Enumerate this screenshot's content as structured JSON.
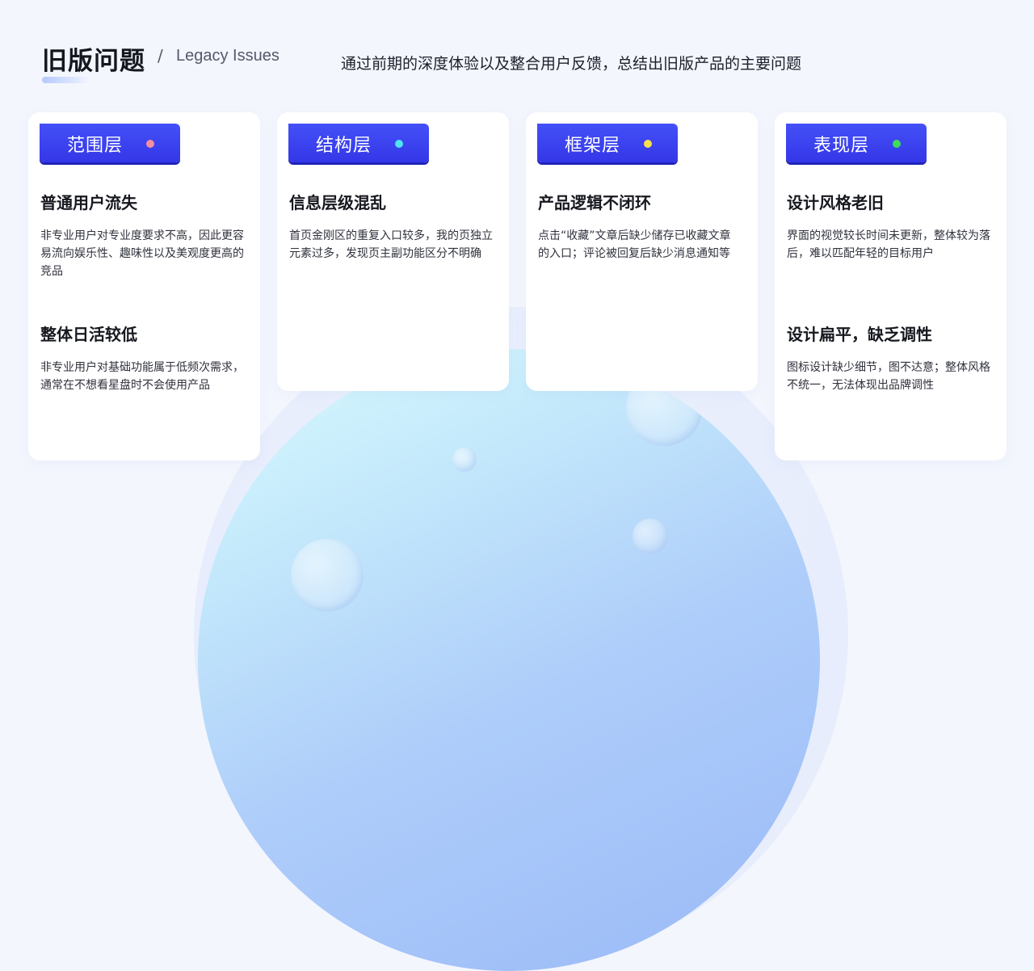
{
  "header": {
    "title": "旧版问题",
    "slash": "/",
    "title_en": "Legacy Issues",
    "subtitle": "通过前期的深度体验以及整合用户反馈，总结出旧版产品的主要问题"
  },
  "colors": {
    "tag_blue": "#3a3ff0",
    "background": "#f3f6fd",
    "card": "#ffffff"
  },
  "cards": [
    {
      "tag": "范围层",
      "dot_color": "#f58fa0",
      "issues": [
        {
          "title": "普通用户流失",
          "text": "非专业用户对专业度要求不高，因此更容易流向娱乐性、趣味性以及美观度更高的竞品"
        },
        {
          "title": "整体日活较低",
          "text": "非专业用户对基础功能属于低频次需求，通常在不想看星盘时不会使用产品"
        }
      ]
    },
    {
      "tag": "结构层",
      "dot_color": "#4ee4f0",
      "issues": [
        {
          "title": "信息层级混乱",
          "text": "首页金刚区的重复入口较多，我的页独立元素过多，发现页主副功能区分不明确"
        }
      ]
    },
    {
      "tag": "框架层",
      "dot_color": "#f7e04a",
      "issues": [
        {
          "title": "产品逻辑不闭环",
          "text": "点击“收藏”文章后缺少储存已收藏文章的入口；评论被回复后缺少消息通知等"
        }
      ]
    },
    {
      "tag": "表现层",
      "dot_color": "#3ddc5a",
      "issues": [
        {
          "title": "设计风格老旧",
          "text": "界面的视觉较长时间未更新，整体较为落后，难以匹配年轻的目标用户"
        },
        {
          "title": "设计扁平，缺乏调性",
          "text": "图标设计缺少细节，图不达意；整体风格不统一，无法体现出品牌调性"
        }
      ]
    }
  ]
}
